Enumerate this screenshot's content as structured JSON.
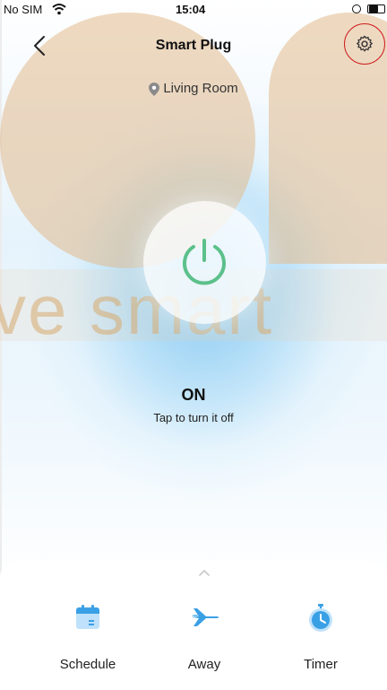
{
  "status_bar": {
    "carrier": "No SIM",
    "time": "15:04"
  },
  "header": {
    "title": "Smart Plug",
    "location": "Living Room"
  },
  "overlay": {
    "watermark": "ve smart"
  },
  "device": {
    "state": "ON",
    "hint": "Tap to turn it off"
  },
  "actions": [
    {
      "label": "Schedule",
      "icon": "calendar-icon"
    },
    {
      "label": "Away",
      "icon": "airplane-icon"
    },
    {
      "label": "Timer",
      "icon": "stopwatch-icon"
    }
  ],
  "colors": {
    "accent": "#3aa0e6",
    "power_green": "#5cc08a",
    "highlight_red": "#d02020"
  }
}
